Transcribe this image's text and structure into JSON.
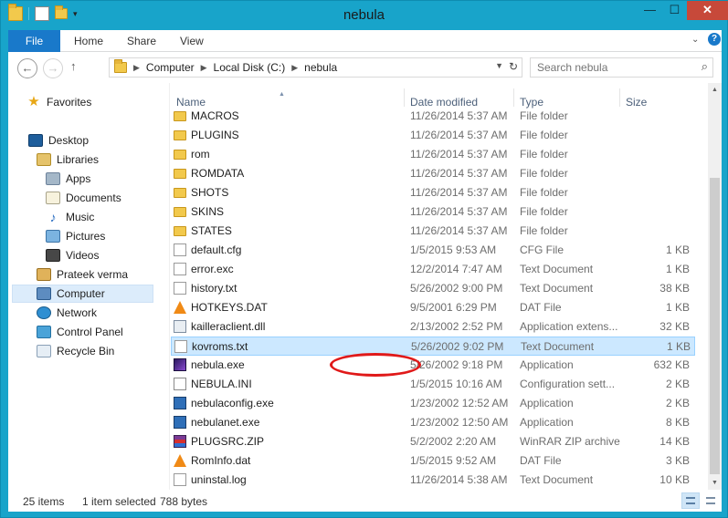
{
  "window": {
    "title": "nebula",
    "controls": {
      "minimize": "—",
      "maximize": "☐",
      "close": "✕"
    }
  },
  "ribbon": {
    "tabs": [
      "File",
      "Home",
      "Share",
      "View"
    ],
    "expand_icon": "chevron-down-icon",
    "help": "?"
  },
  "address": {
    "crumbs": [
      "Computer",
      "Local Disk (C:)",
      "nebula"
    ],
    "search_placeholder": "Search nebula"
  },
  "nav_pane": {
    "favorites": "Favorites",
    "desktop": "Desktop",
    "libraries": "Libraries",
    "apps": "Apps",
    "documents": "Documents",
    "music": "Music",
    "pictures": "Pictures",
    "videos": "Videos",
    "user": "Prateek verma",
    "computer": "Computer",
    "network": "Network",
    "control_panel": "Control Panel",
    "recycle_bin": "Recycle Bin"
  },
  "columns": {
    "name": "Name",
    "date": "Date modified",
    "type": "Type",
    "size": "Size"
  },
  "files": [
    {
      "name": "MACROS",
      "date": "11/26/2014 5:37 AM",
      "type": "File folder",
      "size": "",
      "icon": "folder"
    },
    {
      "name": "PLUGINS",
      "date": "11/26/2014 5:37 AM",
      "type": "File folder",
      "size": "",
      "icon": "folder"
    },
    {
      "name": "rom",
      "date": "11/26/2014 5:37 AM",
      "type": "File folder",
      "size": "",
      "icon": "folder"
    },
    {
      "name": "ROMDATA",
      "date": "11/26/2014 5:37 AM",
      "type": "File folder",
      "size": "",
      "icon": "folder"
    },
    {
      "name": "SHOTS",
      "date": "11/26/2014 5:37 AM",
      "type": "File folder",
      "size": "",
      "icon": "folder"
    },
    {
      "name": "SKINS",
      "date": "11/26/2014 5:37 AM",
      "type": "File folder",
      "size": "",
      "icon": "folder"
    },
    {
      "name": "STATES",
      "date": "11/26/2014 5:37 AM",
      "type": "File folder",
      "size": "",
      "icon": "folder"
    },
    {
      "name": "default.cfg",
      "date": "1/5/2015 9:53 AM",
      "type": "CFG File",
      "size": "1 KB",
      "icon": "doc"
    },
    {
      "name": "error.exc",
      "date": "12/2/2014 7:47 AM",
      "type": "Text Document",
      "size": "1 KB",
      "icon": "doc"
    },
    {
      "name": "history.txt",
      "date": "5/26/2002 9:00 PM",
      "type": "Text Document",
      "size": "38 KB",
      "icon": "doc"
    },
    {
      "name": "HOTKEYS.DAT",
      "date": "9/5/2001 6:29 PM",
      "type": "DAT File",
      "size": "1 KB",
      "icon": "vlc"
    },
    {
      "name": "kailleraclient.dll",
      "date": "2/13/2002 2:52 PM",
      "type": "Application extens...",
      "size": "32 KB",
      "icon": "dll"
    },
    {
      "name": "kovroms.txt",
      "date": "5/26/2002 9:02 PM",
      "type": "Text Document",
      "size": "1 KB",
      "icon": "doc",
      "selected": true
    },
    {
      "name": "nebula.exe",
      "date": "5/26/2002 9:18 PM",
      "type": "Application",
      "size": "632 KB",
      "icon": "nebula"
    },
    {
      "name": "NEBULA.INI",
      "date": "1/5/2015 10:16 AM",
      "type": "Configuration sett...",
      "size": "2 KB",
      "icon": "ini"
    },
    {
      "name": "nebulaconfig.exe",
      "date": "1/23/2002 12:52 AM",
      "type": "Application",
      "size": "2 KB",
      "icon": "exe"
    },
    {
      "name": "nebulanet.exe",
      "date": "1/23/2002 12:50 AM",
      "type": "Application",
      "size": "8 KB",
      "icon": "exe"
    },
    {
      "name": "PLUGSRC.ZIP",
      "date": "5/2/2002 2:20 AM",
      "type": "WinRAR ZIP archive",
      "size": "14 KB",
      "icon": "zip"
    },
    {
      "name": "RomInfo.dat",
      "date": "1/5/2015 9:52 AM",
      "type": "DAT File",
      "size": "3 KB",
      "icon": "vlc"
    },
    {
      "name": "uninstal.log",
      "date": "11/26/2014 5:38 AM",
      "type": "Text Document",
      "size": "10 KB",
      "icon": "doc"
    }
  ],
  "status": {
    "item_count": "25 items",
    "selected": "1 item selected",
    "size": "788 bytes"
  },
  "colors": {
    "window_frame": "#18a4ca",
    "file_tab": "#1979ca",
    "selection": "#cce8ff",
    "annotation": "#e01919"
  }
}
